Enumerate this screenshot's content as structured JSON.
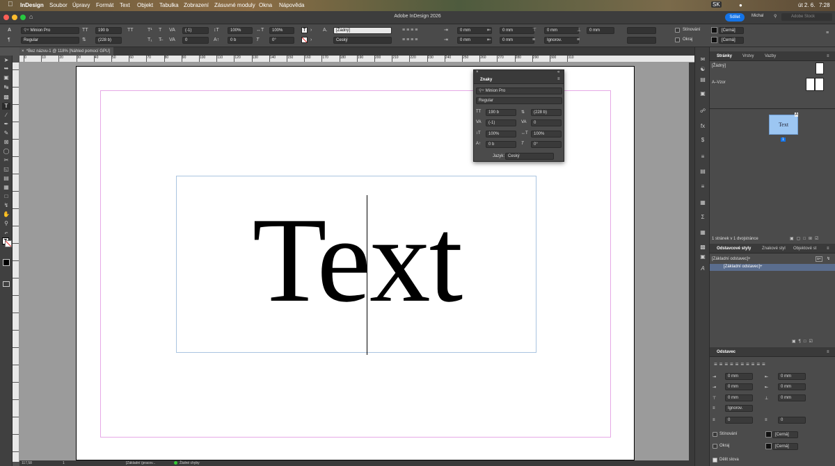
{
  "menubar": {
    "app": "InDesign",
    "items": [
      "Soubor",
      "Úpravy",
      "Formát",
      "Text",
      "Objekt",
      "Tabulka",
      "Zobrazení",
      "Zásuvné moduly",
      "Okna",
      "Nápověda"
    ],
    "lang_badge": "SK",
    "date": "út 2. 6.",
    "time": "7:28"
  },
  "titlebar": {
    "title": "Adobe InDesign 2026",
    "share": "Sdílet",
    "user": "Michal",
    "stock_placeholder": "Adobe Stock"
  },
  "control": {
    "font": "Minion Pro",
    "style": "Regular",
    "size": "190 b",
    "leading": "(228 b)",
    "kerning": "(-1)",
    "tracking": "0",
    "vscale": "100%",
    "hscale": "100%",
    "baseline": "0 b",
    "skew": "0°",
    "char_style": "[Žádný]",
    "language": "Český",
    "left_indent": "0 mm",
    "right_indent": "0 mm",
    "first_indent": "0 mm",
    "last_indent": "0 mm",
    "space_before": "0 mm",
    "space_after": "0 mm",
    "align_to_grid": "Ignorov.",
    "shading": "Stínování",
    "border": "Okraj",
    "swatch": "[Černá]"
  },
  "document": {
    "tab": "*Bez názvu-1 @ 118% [Náhled pomocí GPU]",
    "text": "Text",
    "ruler": [
      "0",
      "10",
      "20",
      "30",
      "40",
      "50",
      "60",
      "70",
      "80",
      "90",
      "100",
      "110",
      "120",
      "130",
      "140",
      "150",
      "160",
      "170",
      "180",
      "190",
      "200",
      "210",
      "220",
      "230",
      "240",
      "250",
      "260",
      "270",
      "280",
      "290",
      "300",
      "310"
    ]
  },
  "status": {
    "zoom": "117,58",
    "page": "1",
    "style": "[Základní (pracov...",
    "errors": "Žádné chyby"
  },
  "znaky": {
    "title": "Znaky",
    "font": "Minion Pro",
    "style": "Regular",
    "size": "190 b",
    "leading": "(228 b)",
    "kerning": "(-1)",
    "tracking": "0",
    "vscale": "100%",
    "hscale": "100%",
    "baseline": "0 b",
    "skew": "0°",
    "lang_label": "Jazyk:",
    "lang": "Český"
  },
  "pages_panel": {
    "tabs": [
      "Stránky",
      "Vrstvy",
      "Vazby"
    ],
    "none": "[Žádný]",
    "master": "A–Vzor",
    "thumb_text": "Text",
    "thumb_master": "A",
    "page_number": "1",
    "footer": "1 stránek v 1 dvojstránce"
  },
  "para_styles_panel": {
    "tabs": [
      "Odstavcové styly",
      "Znakové styl",
      "Objektové st"
    ],
    "header": "[Základní odstavec]+",
    "item": "[Základní odstavec]+"
  },
  "paragraph_panel": {
    "title": "Odstavec",
    "left_indent": "0 mm",
    "right_indent": "0 mm",
    "first_indent": "0 mm",
    "last_indent": "0 mm",
    "space_before": "0 mm",
    "space_after": "0 mm",
    "align_to_grid": "Ignorov.",
    "dropcap_lines": "0",
    "dropcap_chars": "0",
    "shading": "Stínování",
    "border": "Okraj",
    "swatch": "[Černá]",
    "hyphenate": "Dělit slova"
  },
  "colors": {
    "accent": "#1473e6",
    "frame": "#a9c4e0",
    "margin": "#e6a8e6"
  }
}
